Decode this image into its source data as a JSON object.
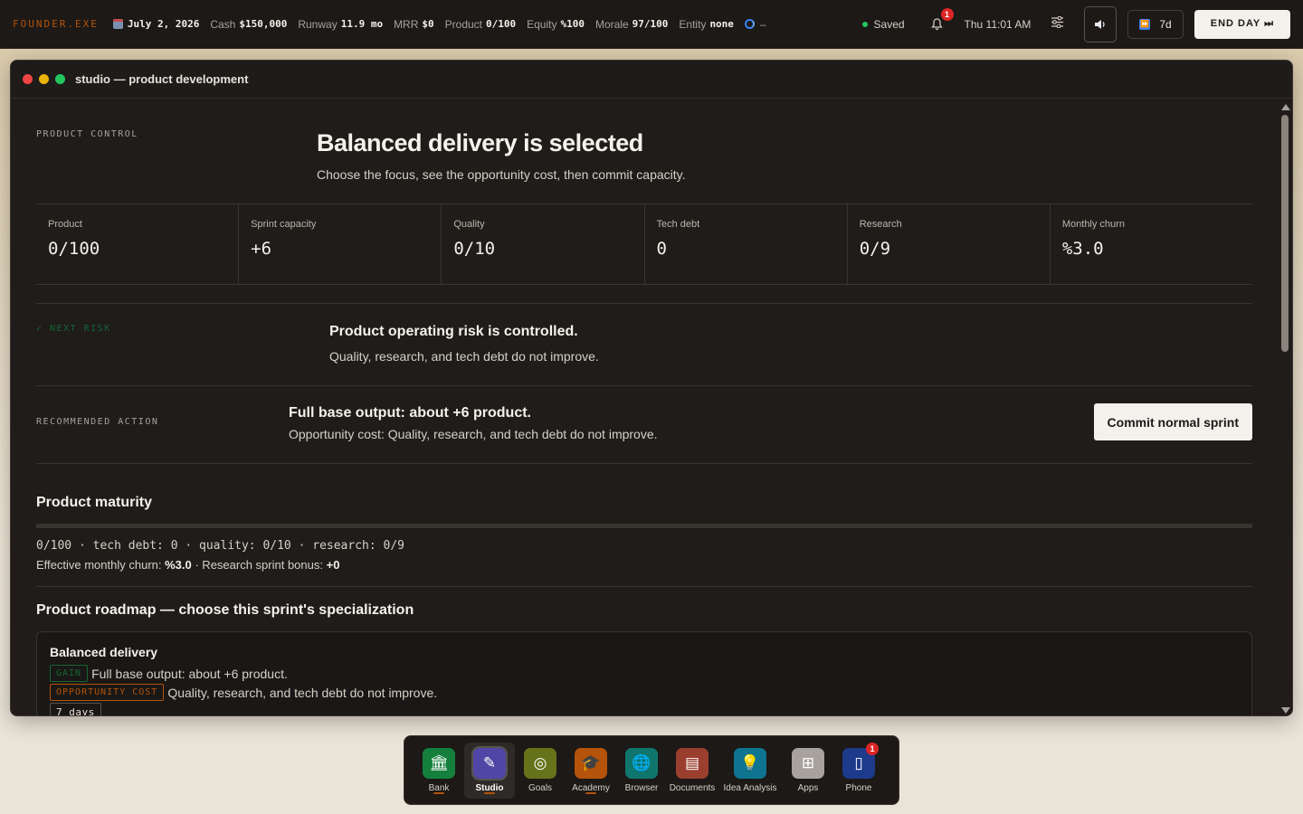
{
  "topbar": {
    "brand": "FOUNDER.EXE",
    "date": "July 2, 2026",
    "cash_label": "Cash",
    "cash": "$150,000",
    "runway_label": "Runway",
    "runway": "11.9 mo",
    "mrr_label": "MRR",
    "mrr": "$0",
    "product_label": "Product",
    "product": "0/100",
    "equity_label": "Equity",
    "equity": "%100",
    "morale_label": "Morale",
    "morale": "97/100",
    "entity_label": "Entity",
    "entity": "none",
    "task_status": "–",
    "saved": "Saved",
    "notifications": "1",
    "clock": "Thu 11:01 AM",
    "fast_forward": "7d",
    "end_day": "END DAY ⏭"
  },
  "window": {
    "title": "studio — product development"
  },
  "product_control": {
    "label": "PRODUCT CONTROL",
    "title": "Balanced delivery is selected",
    "subtitle": "Choose the focus, see the opportunity cost, then commit capacity."
  },
  "metrics": [
    {
      "label": "Product",
      "value": "0/100"
    },
    {
      "label": "Sprint capacity",
      "value": "+6"
    },
    {
      "label": "Quality",
      "value": "0/10"
    },
    {
      "label": "Tech debt",
      "value": "0"
    },
    {
      "label": "Research",
      "value": "0/9"
    },
    {
      "label": "Monthly churn",
      "value": "%3.0"
    }
  ],
  "next_risk": {
    "label": "✓ NEXT RISK",
    "title": "Product operating risk is controlled.",
    "subtitle": "Quality, research, and tech debt do not improve."
  },
  "recommended": {
    "label": "RECOMMENDED ACTION",
    "title": "Full base output: about +6 product.",
    "subtitle": "Opportunity cost: Quality, research, and tech debt do not improve.",
    "button": "Commit normal sprint"
  },
  "maturity": {
    "title": "Product maturity",
    "progress": 0,
    "line": "0/100 · tech debt: 0 · quality: 0/10 · research: 0/9",
    "churn_prefix": "Effective monthly churn: ",
    "churn_value": "%3.0",
    "bonus_prefix": " · Research sprint bonus: ",
    "bonus_value": "+0"
  },
  "roadmap": {
    "title": "Product roadmap — choose this sprint's specialization",
    "card": {
      "title": "Balanced delivery",
      "gain_tag": "GAIN",
      "gain_text": "Full base output: about +6 product.",
      "cost_tag": "OPPORTUNITY COST",
      "cost_text": "Quality, research, and tech debt do not improve.",
      "duration": "7 days"
    }
  },
  "dock": [
    {
      "label": "Bank",
      "icon": "bank-icon",
      "color": "#15803d",
      "glyph": "🏛",
      "indicator": true
    },
    {
      "label": "Studio",
      "icon": "pencil-ruler-icon",
      "color": "#4f46a5",
      "glyph": "✎",
      "active": true,
      "indicator": true
    },
    {
      "label": "Goals",
      "icon": "target-icon",
      "color": "#65731a",
      "glyph": "◎"
    },
    {
      "label": "Academy",
      "icon": "graduation-cap-icon",
      "color": "#b45309",
      "glyph": "🎓",
      "indicator": true
    },
    {
      "label": "Browser",
      "icon": "globe-icon",
      "color": "#0f766e",
      "glyph": "🌐"
    },
    {
      "label": "Documents",
      "icon": "document-icon",
      "color": "#9a3f2e",
      "glyph": "▤"
    },
    {
      "label": "Idea Analysis",
      "icon": "lightbulb-icon",
      "color": "#0e7490",
      "glyph": "💡"
    },
    {
      "label": "Apps",
      "icon": "grid-icon",
      "color": "#a8a29e",
      "glyph": "⊞"
    },
    {
      "label": "Phone",
      "icon": "phone-icon",
      "color": "#1e3a8a",
      "glyph": "▯",
      "badge": "1"
    }
  ]
}
